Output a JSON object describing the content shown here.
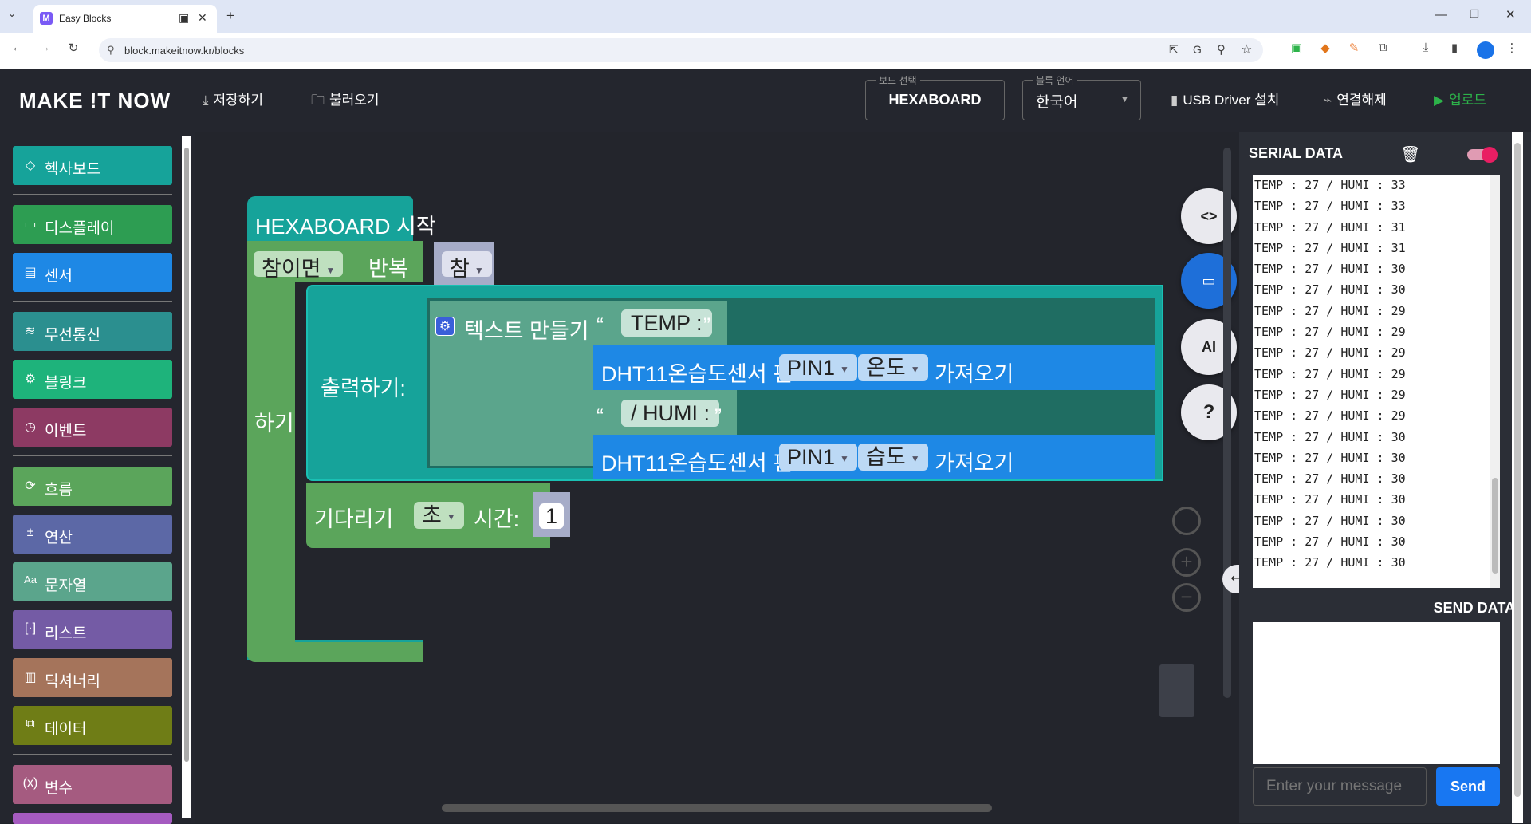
{
  "browser": {
    "tab_title": "Easy Blocks",
    "url": "block.makeitnow.kr/blocks"
  },
  "header": {
    "logo": "MAKE !T NOW",
    "save": "저장하기",
    "load": "불러오기",
    "board_legend": "보드 선택",
    "board": "HEXABOARD",
    "lang_legend": "블록 언어",
    "lang": "한국어",
    "usb": "USB Driver 설치",
    "disconnect": "연결해제",
    "upload": "업로드"
  },
  "categories": [
    {
      "label": "헥사보드",
      "icon": "hexaboard-icon",
      "color": "#16a39a"
    },
    {
      "label": "디스플레이",
      "icon": "display-icon",
      "color": "#2d9d52"
    },
    {
      "label": "센서",
      "icon": "sensor-icon",
      "color": "#1e88e5"
    },
    {
      "label": "무선통신",
      "icon": "wifi-icon",
      "color": "#2b8f8f"
    },
    {
      "label": "블링크",
      "icon": "iot-icon",
      "color": "#1eb37b"
    },
    {
      "label": "이벤트",
      "icon": "clock-icon",
      "color": "#8d3a63"
    },
    {
      "label": "흐름",
      "icon": "loop-icon",
      "color": "#5ba55b"
    },
    {
      "label": "연산",
      "icon": "math-icon",
      "color": "#5c68a6"
    },
    {
      "label": "문자열",
      "icon": "text-icon",
      "color": "#5ba58c"
    },
    {
      "label": "리스트",
      "icon": "list-icon",
      "color": "#745ba5"
    },
    {
      "label": "딕셔너리",
      "icon": "dict-icon",
      "color": "#a5745b"
    },
    {
      "label": "데이터",
      "icon": "data-icon",
      "color": "#6f7d16"
    },
    {
      "label": "변수",
      "icon": "variable-icon",
      "color": "#a55b80"
    }
  ],
  "blocks": {
    "start": "HEXABOARD 시작",
    "while_mode": "참이면",
    "repeat": "반복",
    "true_val": "참",
    "do": "하기",
    "print": "출력하기:",
    "create_text": "텍스트 만들기",
    "str1": "TEMP :",
    "sensor1": "DHT11온습도센서 핀:",
    "pin1": "PIN1",
    "temp": "온도",
    "get": "가져오기",
    "str2": "/ HUMI :",
    "sensor2": "DHT11온습도센서 핀:",
    "pin2": "PIN1",
    "humi": "습도",
    "get2": "가져오기",
    "wait": "기다리기",
    "unit": "초",
    "time": "시간:",
    "wait_val": "1"
  },
  "toolbar": {
    "code": "<>",
    "ai": "AI",
    "help": "?"
  },
  "serial": {
    "title": "SERIAL DATA",
    "lines": [
      "TEMP : 27 / HUMI : 33",
      "TEMP : 27 / HUMI : 33",
      "TEMP : 27 / HUMI : 31",
      "TEMP : 27 / HUMI : 31",
      "TEMP : 27 / HUMI : 30",
      "TEMP : 27 / HUMI : 30",
      "TEMP : 27 / HUMI : 29",
      "TEMP : 27 / HUMI : 29",
      "TEMP : 27 / HUMI : 29",
      "TEMP : 27 / HUMI : 29",
      "TEMP : 27 / HUMI : 29",
      "TEMP : 27 / HUMI : 29",
      "TEMP : 27 / HUMI : 30",
      "TEMP : 27 / HUMI : 30",
      "TEMP : 27 / HUMI : 30",
      "TEMP : 27 / HUMI : 30",
      "TEMP : 27 / HUMI : 30",
      "TEMP : 27 / HUMI : 30",
      "TEMP : 27 / HUMI : 30"
    ],
    "send_title": "SEND DATA",
    "placeholder": "Enter your message",
    "send": "Send"
  }
}
